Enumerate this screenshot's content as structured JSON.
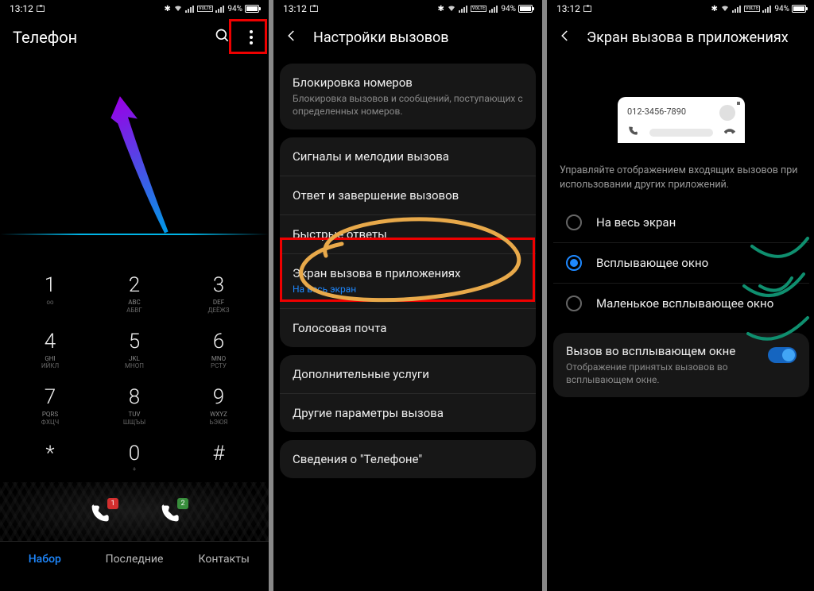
{
  "status": {
    "time": "13:12",
    "battery_pct": "94%",
    "volte": "VoLTE"
  },
  "screen1": {
    "title": "Телефон",
    "keypad": [
      {
        "d": "1",
        "l1": "",
        "l2": "ᴏᴏ"
      },
      {
        "d": "2",
        "l1": "ABC",
        "l2": "АБВГ"
      },
      {
        "d": "3",
        "l1": "DEF",
        "l2": "ДЕЁЖЗ"
      },
      {
        "d": "4",
        "l1": "GHI",
        "l2": "ИЙКЛ"
      },
      {
        "d": "5",
        "l1": "JKL",
        "l2": "МНОП"
      },
      {
        "d": "6",
        "l1": "MNO",
        "l2": "РСТУ"
      },
      {
        "d": "7",
        "l1": "PQRS",
        "l2": "ФХЦЧ"
      },
      {
        "d": "8",
        "l1": "TUV",
        "l2": "ШЩЪЫ"
      },
      {
        "d": "9",
        "l1": "WXYZ",
        "l2": "ЬЭЮЯ"
      },
      {
        "d": "*",
        "l1": "",
        "l2": ""
      },
      {
        "d": "0",
        "l1": "",
        "l2": "+"
      },
      {
        "d": "#",
        "l1": "",
        "l2": ""
      }
    ],
    "sim1_badge": "1",
    "sim2_badge": "2",
    "tabs": {
      "dial": "Набор",
      "recent": "Последние",
      "contacts": "Контакты"
    }
  },
  "screen2": {
    "title": "Настройки вызовов",
    "block": {
      "title": "Блокировка номеров",
      "sub": "Блокировка вызовов и сообщений, поступающих с определенных номеров."
    },
    "rows": {
      "ringtones": "Сигналы и мелодии вызова",
      "answer": "Ответ и завершение вызовов",
      "quick": "Быстрые ответы",
      "screen_title": "Экран вызова в приложениях",
      "screen_sub": "На весь экран",
      "voicemail": "Голосовая почта"
    },
    "rows2": {
      "extra": "Дополнительные услуги",
      "other": "Другие параметры вызова"
    },
    "about": "Сведения о \"Телефоне\""
  },
  "screen3": {
    "title": "Экран вызова в приложениях",
    "preview_number": "012-3456-7890",
    "desc": "Управляйте отображением входящих вызовов при использовании других приложений.",
    "opt_full": "На весь экран",
    "opt_popup": "Всплывающее окно",
    "opt_mini": "Маленькое всплывающее окно",
    "toggle_title": "Вызов во всплывающем окне",
    "toggle_sub": "Отображение принятых вызовов во всплывающем окне."
  }
}
